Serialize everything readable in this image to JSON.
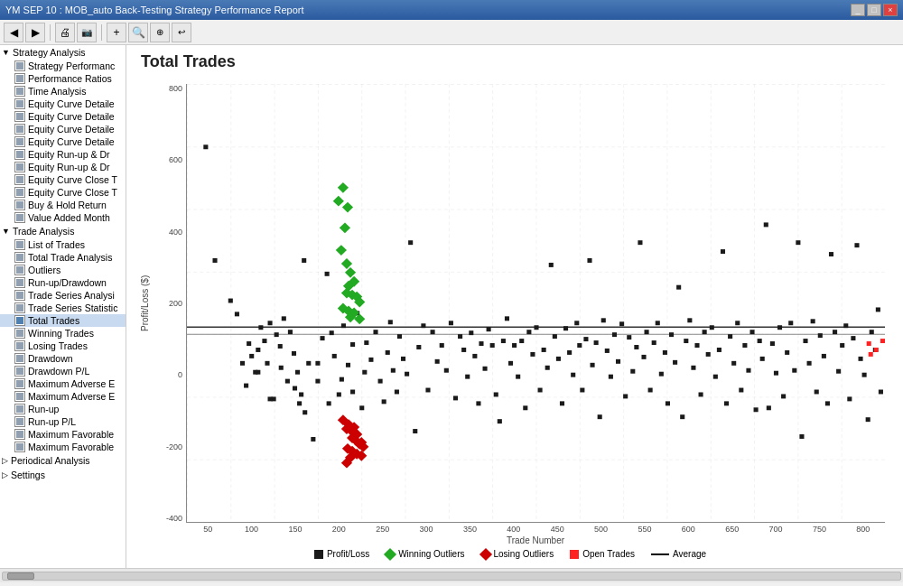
{
  "titleBar": {
    "text": "YM  SEP 10 : MOB_auto Back-Testing Strategy Performance Report",
    "buttons": [
      "_",
      "□",
      "×"
    ]
  },
  "toolbar": {
    "buttons": [
      "◀",
      "▶",
      "⟳",
      "|",
      "🖨",
      "📷",
      "|",
      "➕",
      "🔍",
      "🔭",
      "↩"
    ]
  },
  "sidebar": {
    "sections": [
      {
        "label": "Strategy Analysis",
        "items": [
          "Strategy Performanc",
          "Performance Ratios",
          "Time Analysis",
          "Equity Curve Detaile",
          "Equity Curve Detaile",
          "Equity Curve Detaile",
          "Equity Curve Detaile",
          "Equity Run-up & Dr",
          "Equity Run-up & Dr",
          "Equity Curve Close T",
          "Equity Curve Close T",
          "Buy & Hold Return",
          "Value Added Month"
        ]
      },
      {
        "label": "Trade Analysis",
        "items": [
          "List of Trades",
          "Total Trade Analysis",
          "Outliers",
          "Run-up/Drawdown",
          "Trade Series Analysi",
          "Trade Series Statistic",
          "Total Trades",
          "Winning Trades",
          "Losing Trades",
          "Drawdown",
          "Drawdown P/L",
          "Maximum Adverse E",
          "Maximum Adverse E",
          "Run-up",
          "Run-up P/L",
          "Maximum Favorable",
          "Maximum Favorable"
        ]
      },
      {
        "label": "Periodical Analysis",
        "items": []
      },
      {
        "label": "Settings",
        "items": []
      }
    ]
  },
  "chart": {
    "title": "Total Trades",
    "yAxisLabel": "Profit/Loss ($)",
    "xAxisLabel": "Trade Number",
    "yAxisTicks": [
      "800",
      "600",
      "400",
      "200",
      "0",
      "-200",
      "-400"
    ],
    "xAxisTicks": [
      "50",
      "100",
      "150",
      "200",
      "250",
      "300",
      "350",
      "400",
      "450",
      "500",
      "550",
      "600",
      "650",
      "700",
      "750",
      "800"
    ],
    "legend": [
      {
        "label": "Profit/Loss",
        "type": "square",
        "color": "#1a1a1a"
      },
      {
        "label": "Winning Outliers",
        "type": "square",
        "color": "#22aa22"
      },
      {
        "label": "Losing Outliers",
        "type": "square",
        "color": "#cc0000"
      },
      {
        "label": "Open Trades",
        "type": "square",
        "color": "#ff4444"
      },
      {
        "label": "Average",
        "type": "line",
        "color": "#000000"
      }
    ]
  }
}
